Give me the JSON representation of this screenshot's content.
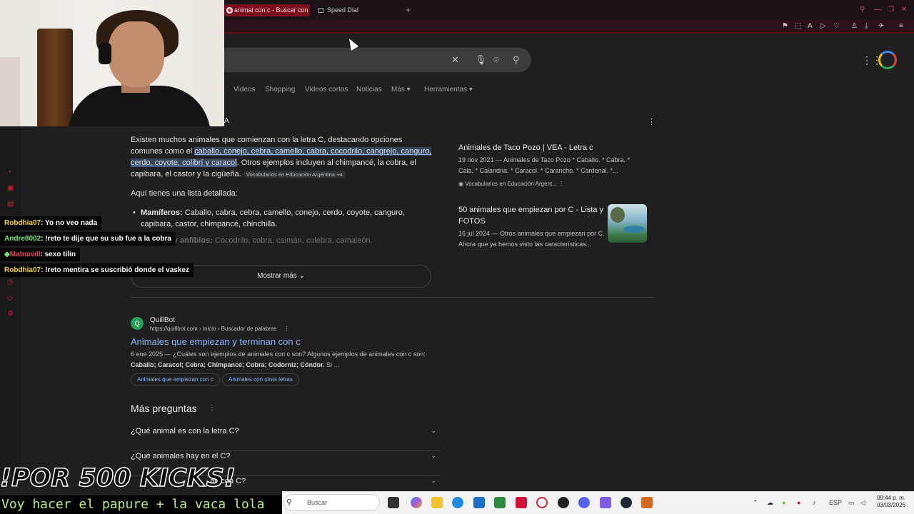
{
  "browser": {
    "tabs": [
      {
        "label": "animal con c - Buscar con"
      },
      {
        "label": "Speed Dial"
      }
    ]
  },
  "search_nav": {
    "tabs": [
      "Videos",
      "Shopping",
      "Videos cortos",
      "Noticias",
      "Más ▾",
      "Herramientas ▾"
    ]
  },
  "ai_overview": {
    "header_fragment": "A",
    "intro_pre": "Existen muchos animales que comienzan con la letra C, destacando opciones comunes como el ",
    "intro_highlight": "caballo, conejo, cebra, camello, cabra, cocodrilo, cangrejo, canguro, cerdo, coyote, colibrí y caracol",
    "intro_post": ". Otros ejemplos incluyen al chimpancé, la cobra, el capibara, el castor y la cigüeña.",
    "intro_source": "Vocabularios en Educación Argentina +4",
    "list_intro": "Aquí tienes una lista detallada:",
    "mammals_label": "Mamíferos:",
    "mammals_text": " Caballo, cabra, cebra, camello, conejo, cerdo, coyote, canguro, capibara, castor, chimpancé, chinchilla.",
    "reptiles_label": "Reptiles y anfibios:",
    "reptiles_text": " Cocodrilo, cobra, caimán, culebra, camaleón.",
    "show_more": "Mostrar más"
  },
  "side_cards": [
    {
      "title": "Animales de Taco Pozo | VEA - Letra c",
      "snippet": "19 nov 2021 — Animales de Taco Pozo * Caballo. * Cabra. * Cala. * Calandria. * Caracol. * Carancho. * Cardenal. *...",
      "source": "Vocabularios en Educación Argent..."
    },
    {
      "title": "50 animales que empiezan por C - Lista y FOTOS",
      "snippet": "16 jul 2024 — Otros animales que empiezan por C. Ahora que ya hemos visto las características..."
    }
  ],
  "result": {
    "site_name": "QuillBot",
    "url": "https://quillbot.com › Inicio › Buscador de palabras",
    "title": "Animales que empiezan y terminan con c",
    "snippet_1": "6 ene 2025 — ¿Cuáles son ejemplos de animales con c son? Algunos ejemplos de animales con c son:",
    "snippet_2": "Caballo; Caracol; Cebra; Chimpancé; Cobra; Codorniz; Cóndor.",
    "snippet_3": " Si ...",
    "pills": [
      "Animales que empiezan con c",
      "Animales con otras letras"
    ]
  },
  "paa": {
    "title": "Más preguntas",
    "questions": [
      "¿Qué animal es con la letra C?",
      "¿Qué animales hay en el C?",
      "an con C?"
    ]
  },
  "chat": [
    {
      "user": "Robdhia07",
      "message": ": Yo no veo nada",
      "color": "#f5d33a"
    },
    {
      "user": "Andre8002",
      "message": ": !reto te dije que su sub fue a la cobra",
      "color": "#7de07a"
    },
    {
      "user": "Matnavill",
      "message": ": sexo tilin",
      "color": "#e0455e"
    },
    {
      "user": "Robdhia07",
      "message": ": !reto mentira se suscribió donde el vaskez",
      "color": "#f5d33a"
    }
  ],
  "overlay": {
    "kicks_banner": "!POR 500 KICKS!",
    "goal_text": "Voy hacer el papure + la vaca lola"
  },
  "taskbar": {
    "search_placeholder": "Buscar",
    "lang": "ESP",
    "time": "09:44 p. m.",
    "date": "03/03/2026"
  },
  "colors": {
    "accent": "#e0455e",
    "link": "#8ab4f8",
    "background": "#1f1f1f"
  }
}
